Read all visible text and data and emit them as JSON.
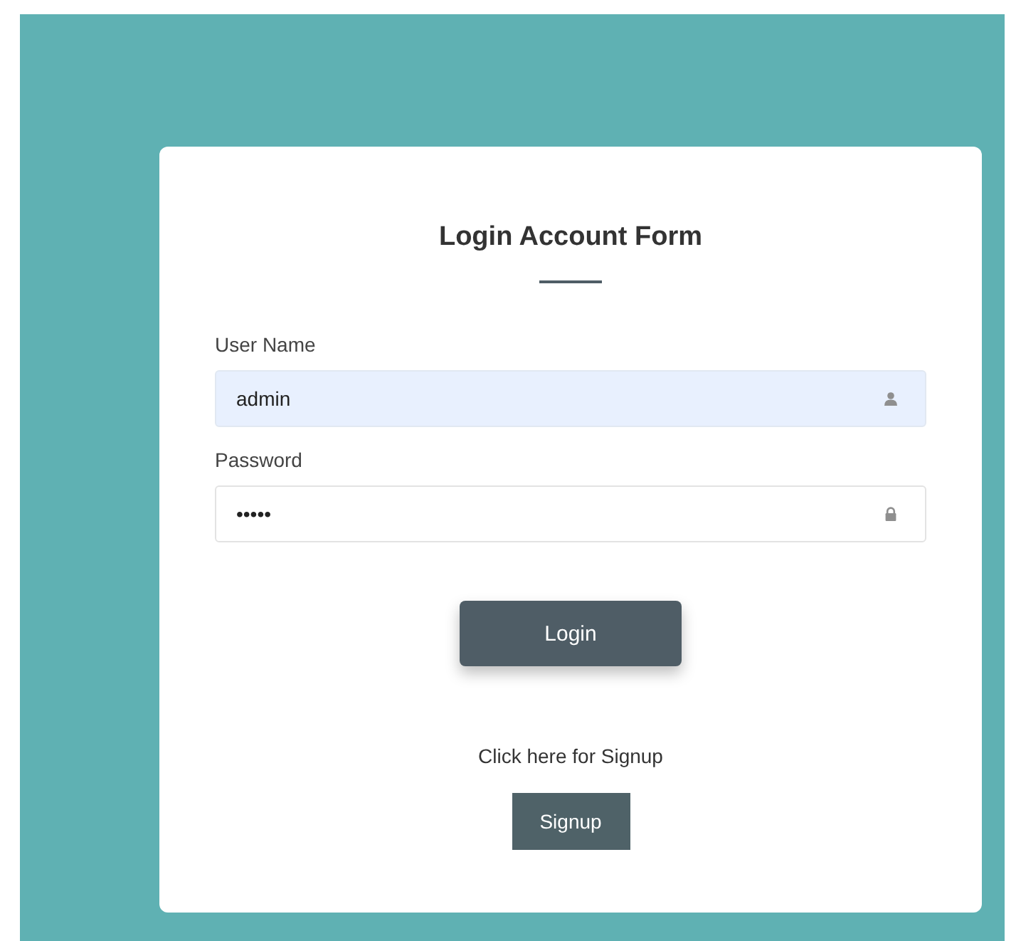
{
  "form": {
    "title": "Login Account Form",
    "fields": [
      {
        "label": "User Name",
        "value": "admin",
        "kind": "user",
        "autofilled": true
      },
      {
        "label": "Password",
        "value": "•••••",
        "kind": "password",
        "autofilled": false
      }
    ],
    "login_button": "Login",
    "signup_prompt": "Click here for Signup",
    "signup_button": "Signup"
  }
}
